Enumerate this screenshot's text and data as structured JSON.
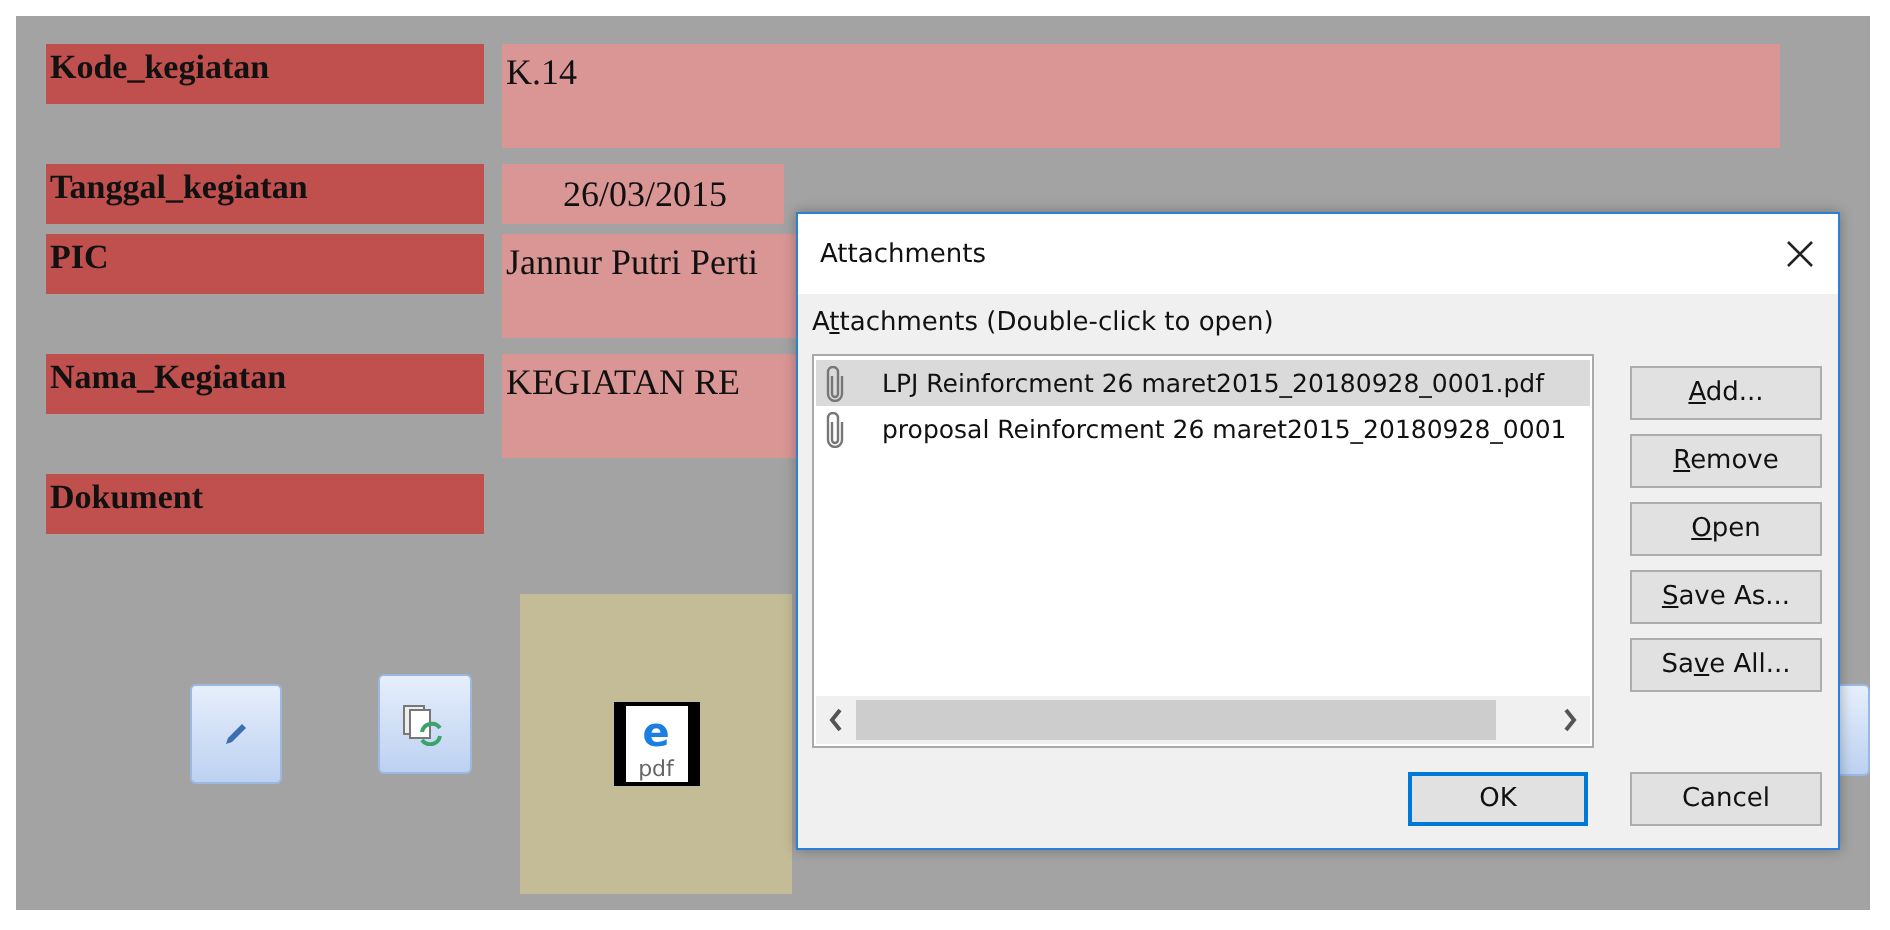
{
  "form": {
    "rows": [
      {
        "label": "Kode_kegiatan",
        "value": "K.14",
        "kind": "tall"
      },
      {
        "label": "Tanggal_kegiatan",
        "value": "26/03/2015",
        "kind": "date"
      },
      {
        "label": "PIC",
        "value": "Jannur Putri Perti",
        "kind": "tall"
      },
      {
        "label": "Nama_Kegiatan",
        "value": "KEGIATAN RE",
        "kind": "tall"
      },
      {
        "label": "Dokument",
        "kind": "empty"
      }
    ]
  },
  "document_icon": {
    "glyph": "e",
    "label": "pdf"
  },
  "dialog": {
    "title": "Attachments",
    "list_label": {
      "pre": "A",
      "key": "t",
      "post": "tachments (Double-click to open)"
    },
    "attachments": [
      {
        "name": "LPJ Reinforcment 26 maret2015_20180928_0001.pdf",
        "selected": true
      },
      {
        "name": "proposal Reinforcment 26 maret2015_20180928_0001",
        "selected": false
      }
    ],
    "side_buttons": [
      {
        "key": "A",
        "post": "dd..."
      },
      {
        "key": "R",
        "post": "emove"
      },
      {
        "key": "O",
        "post": "pen"
      },
      {
        "key": "S",
        "post": "ave As..."
      },
      {
        "pre": "Sa",
        "key": "v",
        "post": "e All..."
      }
    ],
    "footer_buttons": [
      {
        "label": "OK",
        "default": true
      },
      {
        "label": "Cancel",
        "default": false
      }
    ]
  }
}
